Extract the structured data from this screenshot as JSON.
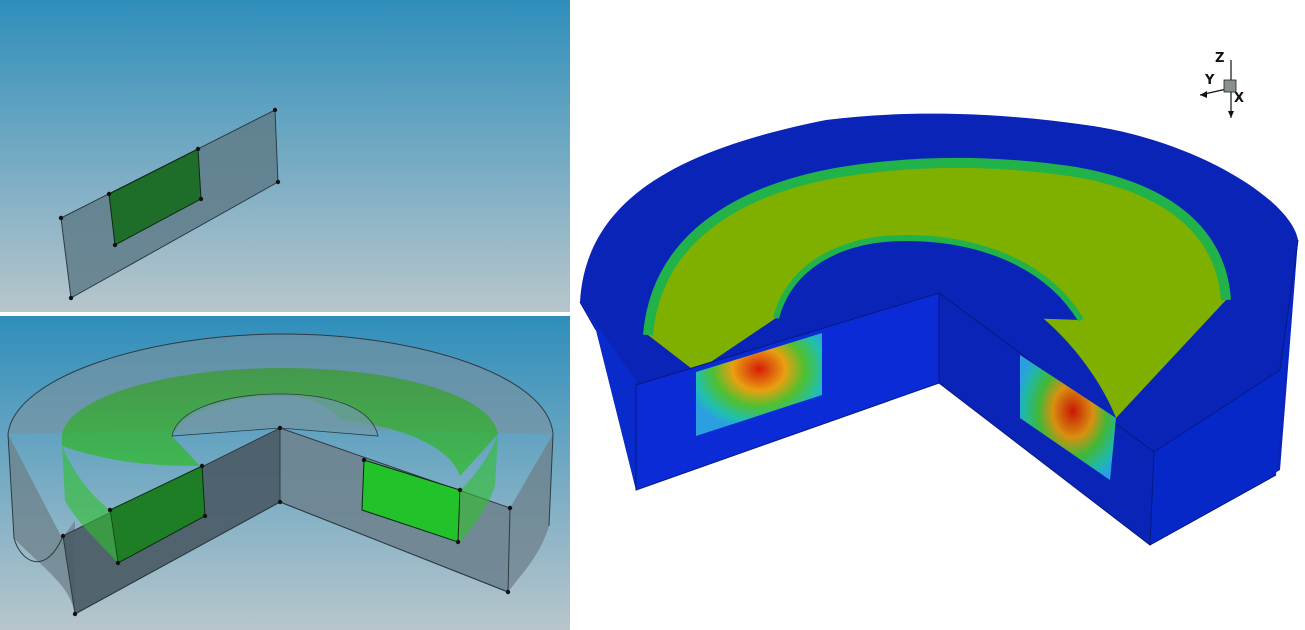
{
  "panels": {
    "top_left": {
      "name": "2d-sketch-viewport"
    },
    "bottom_left": {
      "name": "revolved-geometry-viewport"
    },
    "right": {
      "name": "contour-result-viewport"
    }
  },
  "axis_triad": {
    "z_label": "Z",
    "y_label": "Y",
    "x_label": "X"
  },
  "colors": {
    "viewport_top": "#2f8ebb",
    "viewport_bottom": "#b8c6cc",
    "sketch_plane": "#5f7c8a",
    "sketch_region": "#1e6e2a",
    "ghost_shell": "#7d8f99",
    "inner_region": "#22c22a",
    "field_low": "#0a2bcc",
    "field_mid": "#7fb000",
    "field_green": "#22b24a",
    "field_high": "#e02010"
  }
}
